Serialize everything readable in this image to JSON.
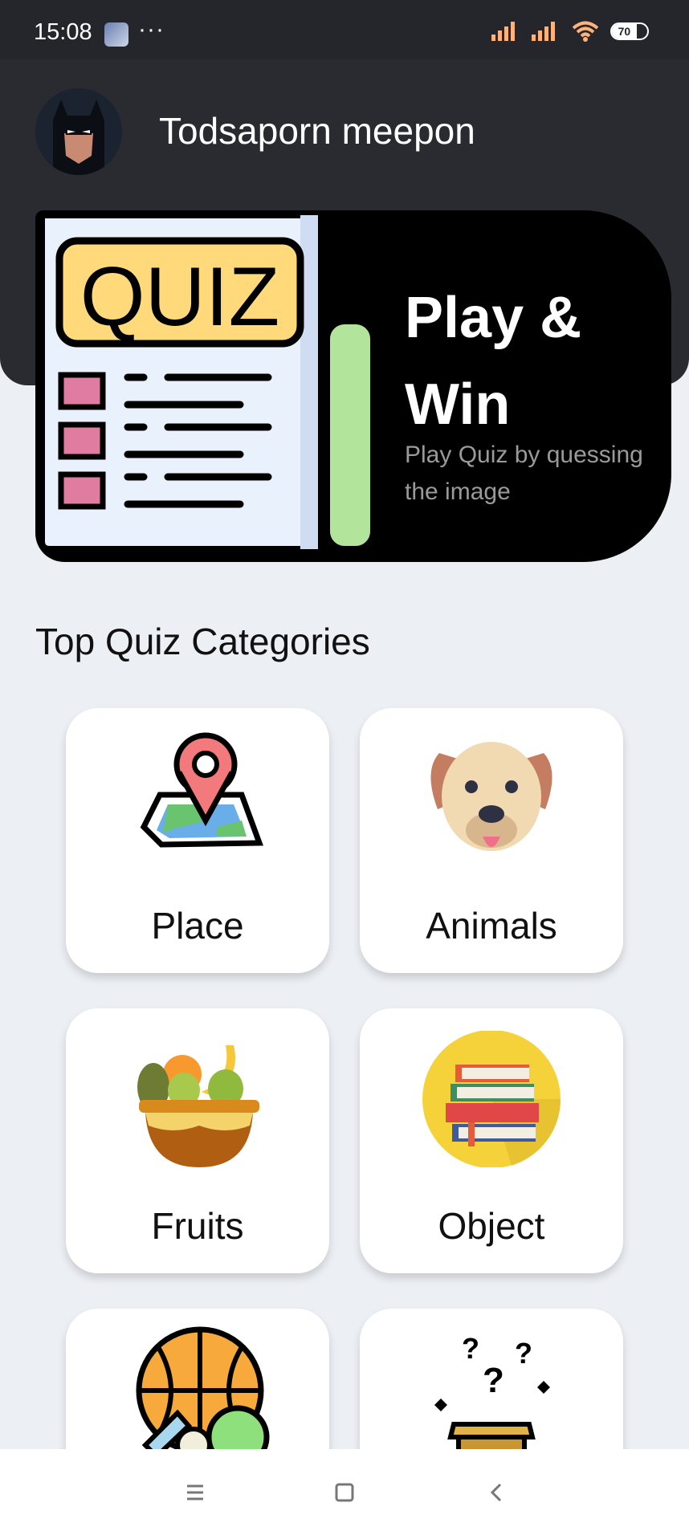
{
  "status_bar": {
    "time": "15:08",
    "dots": "···",
    "battery": "70"
  },
  "header": {
    "username": "Todsaporn meepon"
  },
  "hero": {
    "quiz_word": "QUIZ",
    "title": "Play & Win",
    "subtitle": "Play Quiz by quessing the image"
  },
  "section": {
    "title": "Top Quiz Categories"
  },
  "categories": [
    {
      "label": "Place"
    },
    {
      "label": "Animals"
    },
    {
      "label": "Fruits"
    },
    {
      "label": "Object"
    },
    {
      "label": ""
    },
    {
      "label": ""
    }
  ],
  "colors": {
    "header_bg": "#2a2b30",
    "page_bg": "#eceff4",
    "card_bg": "#ffffff",
    "hero_bg": "#000000"
  }
}
